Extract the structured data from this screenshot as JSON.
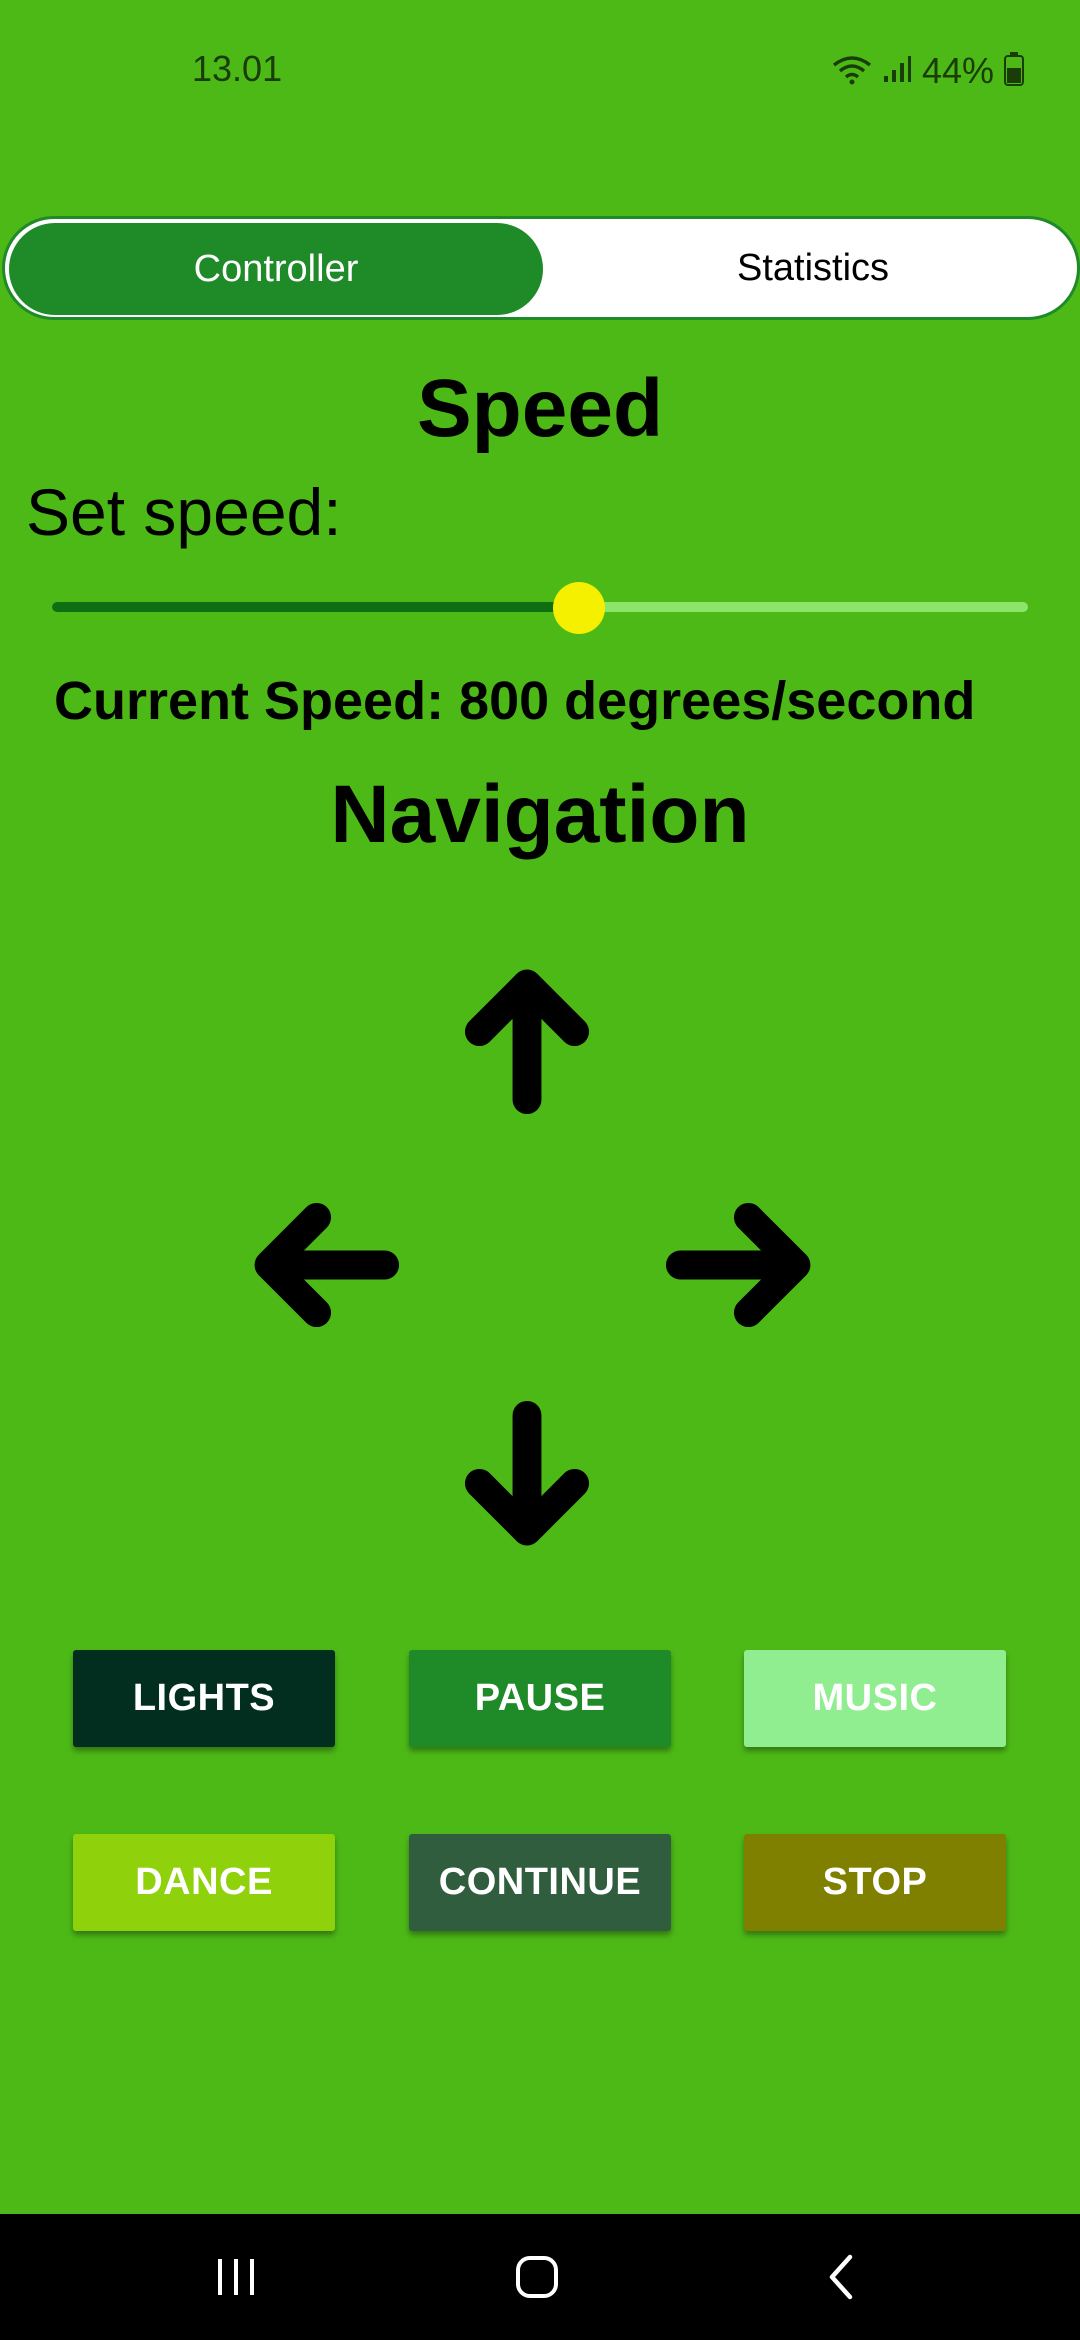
{
  "status_bar": {
    "time": "13.01",
    "battery_percent": "44%",
    "icons": [
      "wifi-icon",
      "signal-icon",
      "battery-icon"
    ]
  },
  "tabs": [
    {
      "label": "Controller",
      "active": true
    },
    {
      "label": "Statistics",
      "active": false
    }
  ],
  "speed": {
    "title": "Speed",
    "set_label": "Set speed:",
    "slider_fraction": 0.54,
    "current_text": "Current Speed: 800 degrees/second"
  },
  "navigation": {
    "title": "Navigation",
    "arrows": [
      "arrow-up-icon",
      "arrow-left-icon",
      "arrow-right-icon",
      "arrow-down-icon"
    ]
  },
  "buttons": [
    {
      "label": "LIGHTS",
      "color": "#022e1f",
      "text_color": "#ffffff"
    },
    {
      "label": "PAUSE",
      "color": "#1e8a28",
      "text_color": "#ffffff"
    },
    {
      "label": "MUSIC",
      "color": "#90ee90",
      "text_color": "#ffffff"
    },
    {
      "label": "DANCE",
      "color": "#8fd10a",
      "text_color": "#ffffff"
    },
    {
      "label": "CONTINUE",
      "color": "#2f5d3e",
      "text_color": "#ffffff"
    },
    {
      "label": "STOP",
      "color": "#7f7f00",
      "text_color": "#ffffff"
    }
  ],
  "colors": {
    "background": "#4db917",
    "accent": "#1e8a28",
    "slider_thumb": "#f5f000"
  },
  "system_nav": [
    "recents-icon",
    "home-icon",
    "back-icon"
  ]
}
